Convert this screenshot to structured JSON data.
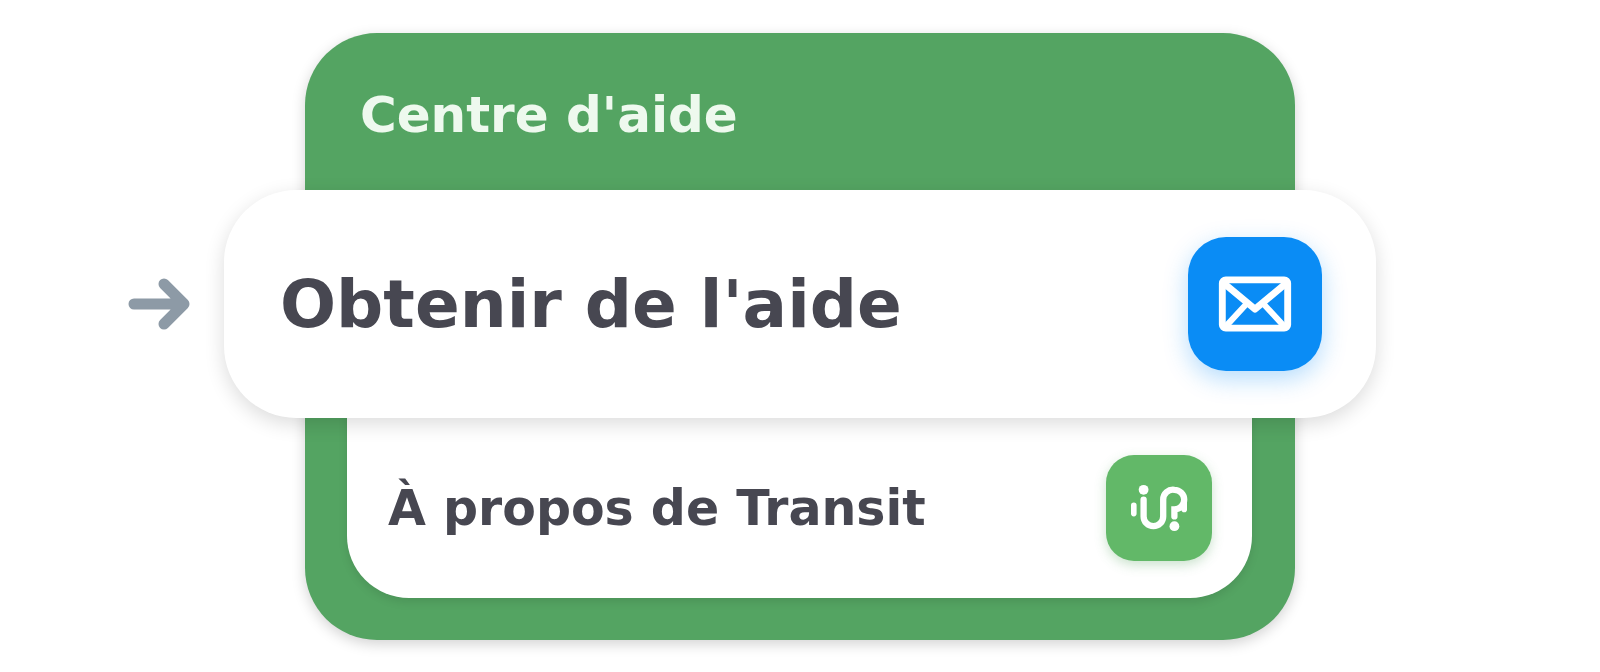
{
  "panel": {
    "title": "Centre d'aide"
  },
  "items": [
    {
      "label": "Obtenir de l'aide",
      "kind": "mail",
      "selected": true
    },
    {
      "label": "À propos de Transit",
      "kind": "transit",
      "selected": false
    }
  ]
}
